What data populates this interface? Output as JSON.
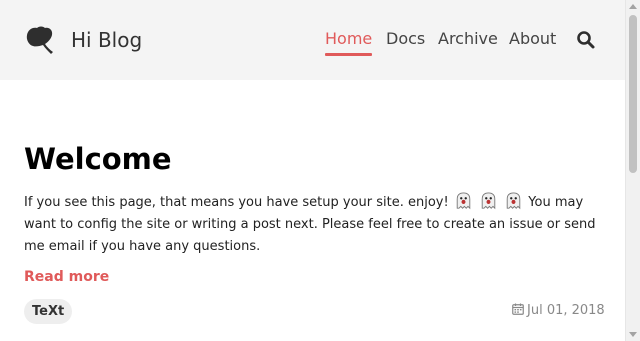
{
  "header": {
    "site_title": "Hi Blog",
    "logo_icon": "ginkgo-leaf-icon",
    "nav": [
      {
        "label": "Home",
        "active": true
      },
      {
        "label": "Docs",
        "active": false
      },
      {
        "label": "Archive",
        "active": false
      },
      {
        "label": "About",
        "active": false
      }
    ],
    "search_icon": "search-icon"
  },
  "post": {
    "title": "Welcome",
    "excerpt_before": "If you see this page, that means you have setup your site. enjoy!",
    "emoji": "ghost-emoji",
    "excerpt_after": "You may want to config the site or writing a post next. Please feel free to create an issue or send me email if you have any questions.",
    "read_more": "Read more",
    "tag": "TeXt",
    "date": "Jul 01, 2018",
    "date_icon": "calendar-icon"
  },
  "colors": {
    "accent": "#e05a5a",
    "header_bg": "#f4f4f4",
    "tag_bg": "#eeeeee",
    "meta_text": "#888888"
  }
}
